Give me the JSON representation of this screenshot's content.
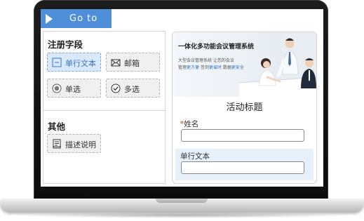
{
  "goto": {
    "label": "Go to"
  },
  "fields_panel": {
    "registration_section_title": "注册字段",
    "other_section_title": "其他",
    "buttons": {
      "single_line_text": "单行文本",
      "email": "邮箱",
      "single_choice": "单选",
      "multiple_choice": "多选",
      "description": "描述说明"
    },
    "selected_button": "单行文本"
  },
  "preview": {
    "banner": {
      "title": "一体化多功能会议管理系统",
      "subtitle": "大型会议管理系统 让您的会议",
      "line2_parts": [
        "管理",
        "更方便",
        "签到",
        "更省时",
        "数据",
        "更安全"
      ]
    },
    "form_title": "活动标题",
    "name_field": {
      "required_mark": "*",
      "label": "姓名"
    },
    "text_field": {
      "label": "单行文本"
    }
  },
  "colors": {
    "accent": "#4f8fda",
    "selected_fill": "#d9e8fb",
    "highlight_fill": "#e6f0fb",
    "required": "#dd3333"
  },
  "icons": {
    "goto": "play-arrow-icon",
    "single_line_text": "text-line-icon",
    "email": "envelope-icon",
    "single_choice": "radio-icon",
    "multiple_choice": "checkbox-circle-icon",
    "description": "document-lines-icon"
  }
}
